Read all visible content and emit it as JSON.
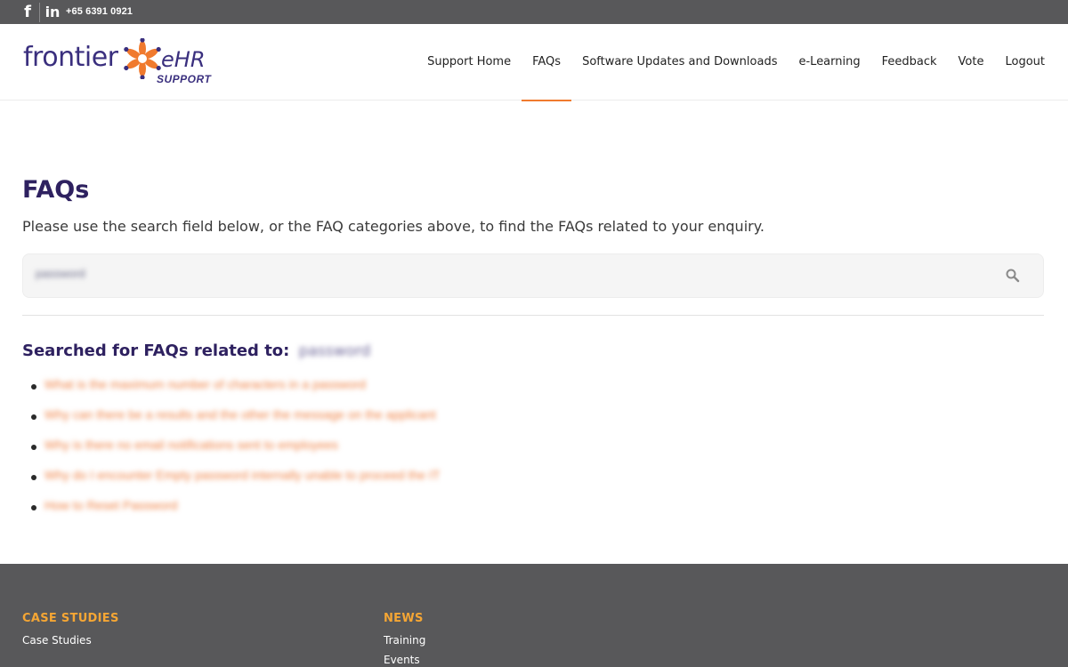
{
  "topbar": {
    "facebook_icon": "facebook-icon",
    "linkedin_icon": "linkedin-icon",
    "phone": "+65 6391 0921"
  },
  "logo": {
    "word1": "frontier",
    "word2": "eHR",
    "word3": "SUPPORT",
    "colors": {
      "primary": "#3a2f7e",
      "accent": "#f07a2e"
    }
  },
  "nav": {
    "items": [
      {
        "label": "Support Home"
      },
      {
        "label": "FAQs",
        "active": true
      },
      {
        "label": "Software Updates and Downloads"
      },
      {
        "label": "e-Learning"
      },
      {
        "label": "Feedback"
      },
      {
        "label": "Vote"
      },
      {
        "label": "Logout"
      }
    ]
  },
  "main": {
    "title": "FAQs",
    "intro": "Please use the search field below, or the FAQ categories above, to find the FAQs related to your enquiry.",
    "search": {
      "value": "password",
      "icon": "search-icon"
    },
    "results_heading": "Searched for FAQs related to:",
    "results_term": "password",
    "results": [
      "What is the maximum number of characters in a password",
      "Why can there be a results and the other the message on the applicant",
      "Why is there no email notifications sent to employees",
      "Why do I encounter Empty password internally unable to proceed the IT",
      "How to Reset Password"
    ]
  },
  "footer": {
    "col1": {
      "heading": "CASE STUDIES",
      "links": [
        "Case Studies"
      ]
    },
    "col2": {
      "heading": "NEWS",
      "links": [
        "Training",
        "Events"
      ]
    },
    "colors": {
      "heading": "#f5a634",
      "background": "#58585a"
    }
  }
}
